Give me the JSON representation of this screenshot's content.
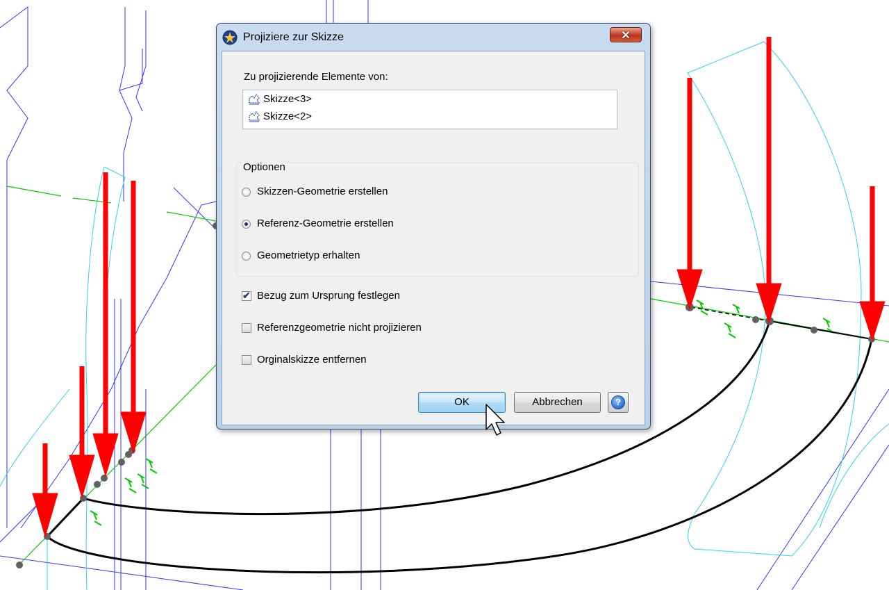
{
  "dialog": {
    "title": "Projiziere zur Skizze",
    "close_label": "✕",
    "elements_label": "Zu projizierende Elemente von:",
    "elements": [
      {
        "label": "Skizze<3>",
        "icon": "sketch-icon"
      },
      {
        "label": "Skizze<2>",
        "icon": "sketch-icon"
      }
    ],
    "options_legend": "Optionen",
    "radio_options": [
      {
        "label": "Skizzen-Geometrie erstellen",
        "checked": false
      },
      {
        "label": "Referenz-Geometrie erstellen",
        "checked": true
      },
      {
        "label": "Geometrietyp erhalten",
        "checked": false
      }
    ],
    "checkboxes": [
      {
        "label": "Bezug zum Ursprung festlegen",
        "checked": true
      },
      {
        "label": "Referenzgeometrie nicht projizieren",
        "checked": false
      },
      {
        "label": "Orginalskizze entfernen",
        "checked": false
      }
    ],
    "ok_label": "OK",
    "cancel_label": "Abbrechen",
    "help_label": "?"
  },
  "colors": {
    "arrow": "#ff0000",
    "construction_line": "#00cc00",
    "edge_line": "#3333ff",
    "silhouette_line": "#33ccff",
    "sketch_curve": "#000000",
    "point": "#606060"
  }
}
